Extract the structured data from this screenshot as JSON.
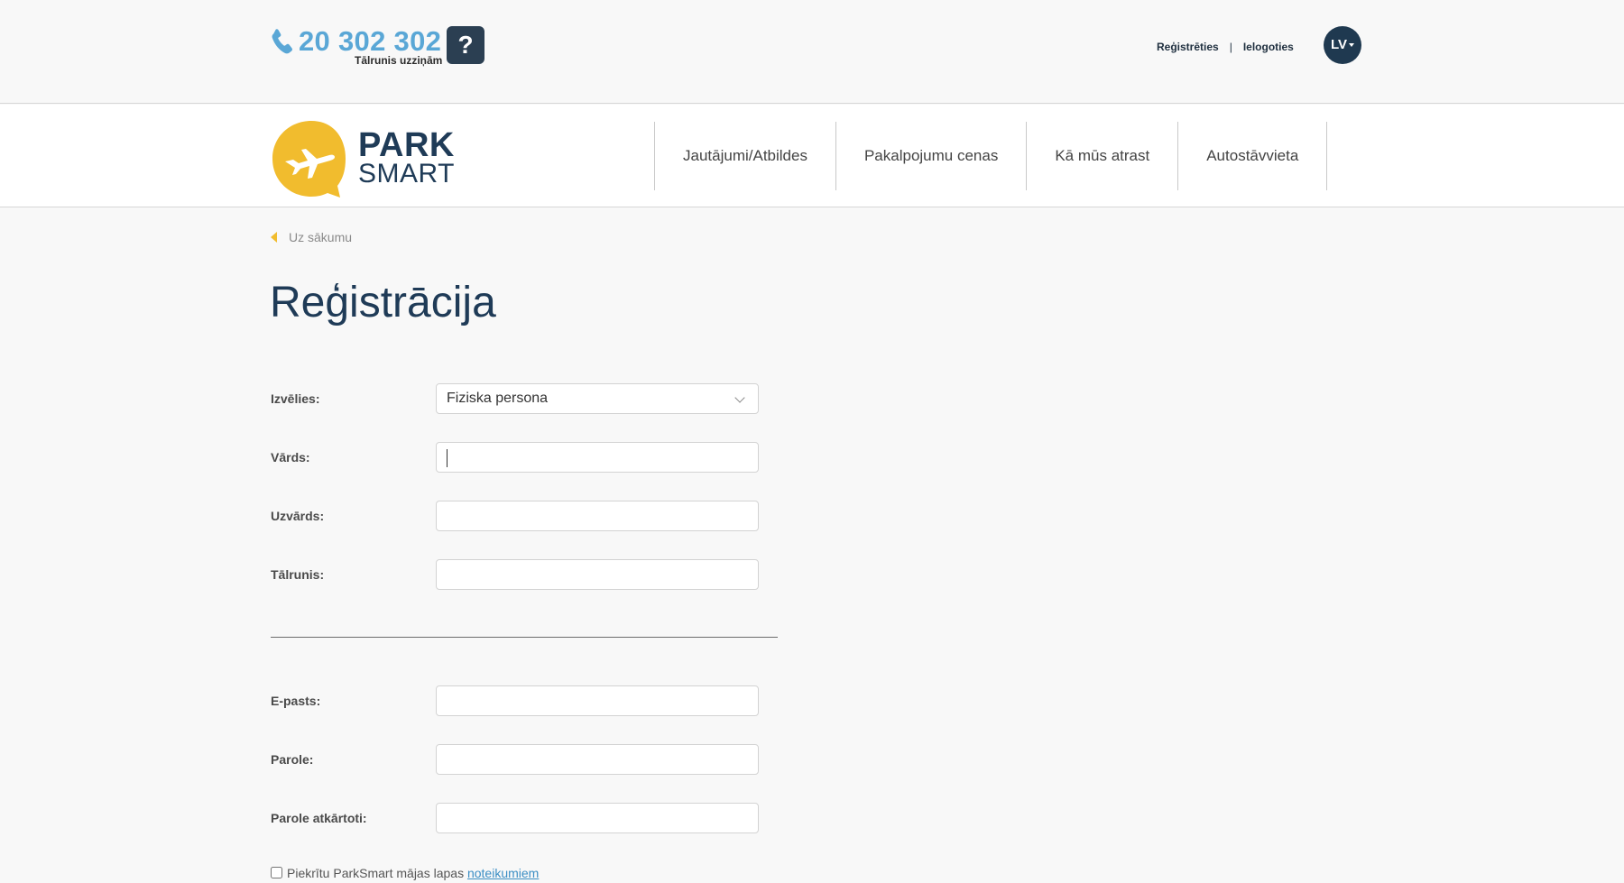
{
  "header": {
    "phone": "20 302 302",
    "phone_sub": "Tālrunis uzziņām",
    "help": "?",
    "register": "Reģistrēties",
    "separator": "|",
    "login": "Ielogoties",
    "language": "LV"
  },
  "logo": {
    "line1": "PARK",
    "line2": "SMART"
  },
  "nav": [
    "Jautājumi/Atbildes",
    "Pakalpojumu cenas",
    "Kā mūs atrast",
    "Autostāvvieta"
  ],
  "breadcrumb": "Uz sākumu",
  "title": "Reģistrācija",
  "form": {
    "type_label": "Izvēlies:",
    "type_value": "Fiziska persona",
    "first_name_label": "Vārds:",
    "last_name_label": "Uzvārds:",
    "phone_label": "Tālrunis:",
    "email_label": "E-pasts:",
    "password_label": "Parole:",
    "password_repeat_label": "Parole atkārtoti:",
    "terms_text": "Piekrītu ParkSmart mājas lapas",
    "terms_link": "noteikumiem"
  },
  "colors": {
    "accent": "#f1bc2e",
    "brand_dark": "#1f3b57",
    "link": "#5aa7d6"
  }
}
